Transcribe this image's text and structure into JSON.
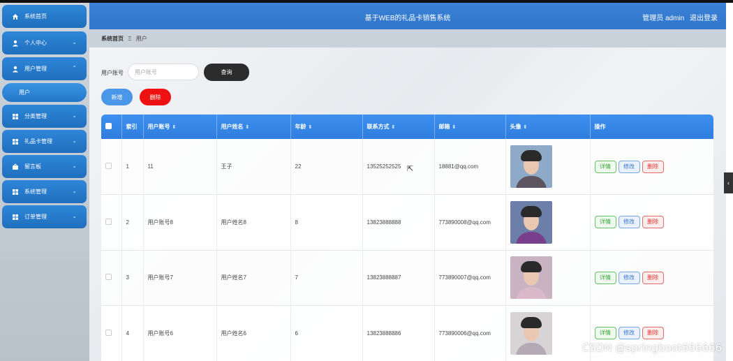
{
  "app": {
    "title": "基于WEB的礼品卡销售系统",
    "user_label": "管理员 admin",
    "logout": "退出登录"
  },
  "sidebar": {
    "items": [
      {
        "label": "系统首页",
        "icon": "home-icon"
      },
      {
        "label": "个人中心",
        "icon": "user-icon"
      },
      {
        "label": "用户管理",
        "icon": "user-icon",
        "expanded": true
      },
      {
        "label": "分类管理",
        "icon": "grid-icon"
      },
      {
        "label": "礼品卡管理",
        "icon": "grid-icon"
      },
      {
        "label": "留言板",
        "icon": "board-icon"
      },
      {
        "label": "系统管理",
        "icon": "grid-icon"
      },
      {
        "label": "订单管理",
        "icon": "grid-icon"
      }
    ],
    "sub_item": "用户"
  },
  "breadcrumb": {
    "home": "系统首页",
    "separator": "Ξ",
    "current": "用户"
  },
  "search": {
    "label": "用户账号",
    "placeholder": "用户账号",
    "value": "",
    "button": "查询"
  },
  "actions": {
    "add": "新增",
    "delete": "删除"
  },
  "table": {
    "columns": [
      "索引",
      "用户账号",
      "用户姓名",
      "年龄",
      "联系方式",
      "邮箱",
      "头像",
      "操作"
    ],
    "sort_icon": "⇕",
    "rows": [
      {
        "index": "1",
        "account": "11",
        "name": "王子",
        "age": "22",
        "phone": "13525252525",
        "email": "18881@qq.com",
        "avatar_bg": "#8fa9c9",
        "avatar_body": "#5d5560"
      },
      {
        "index": "2",
        "account": "用户账号8",
        "name": "用户姓名8",
        "age": "8",
        "phone": "13823888888",
        "email": "773890008@qq.com",
        "avatar_bg": "#6b7fa8",
        "avatar_body": "#7a3f8c"
      },
      {
        "index": "3",
        "account": "用户账号7",
        "name": "用户姓名7",
        "age": "7",
        "phone": "13823888887",
        "email": "773890007@qq.com",
        "avatar_bg": "#c9b3c3",
        "avatar_body": "#d9b8c8"
      },
      {
        "index": "4",
        "account": "用户账号6",
        "name": "用户姓名6",
        "age": "6",
        "phone": "13823888886",
        "email": "773890006@qq.com",
        "avatar_bg": "#d8d4d6",
        "avatar_body": "#b5a9b6"
      }
    ],
    "ops": {
      "detail": "详情",
      "edit": "修改",
      "remove": "删除"
    }
  },
  "watermark": "CSDN @springboot666666",
  "colors": {
    "primary": "#2f76cc",
    "danger": "#ee1111",
    "query_button": "#2c2c2c"
  }
}
